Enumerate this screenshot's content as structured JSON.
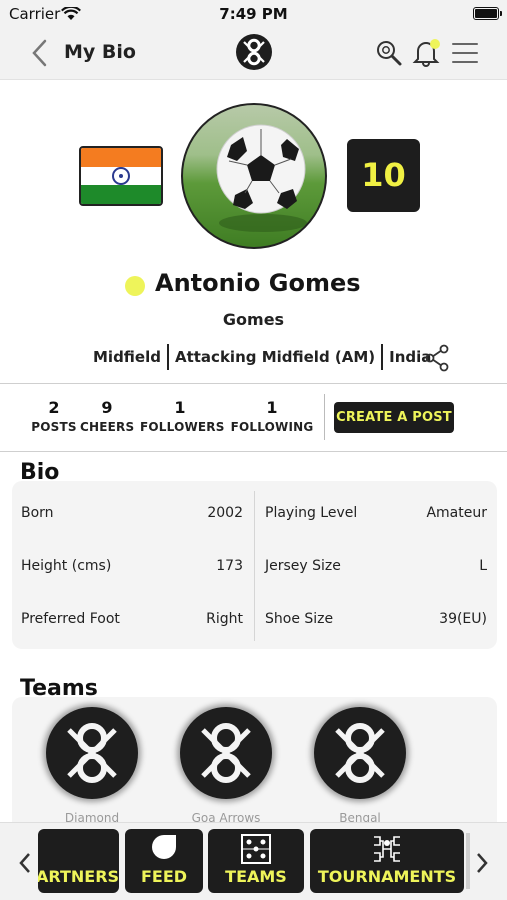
{
  "status_bar": {
    "carrier": "Carrier",
    "time": "7:49 PM"
  },
  "nav": {
    "title": "My Bio"
  },
  "profile": {
    "jersey_number": "10",
    "name": "Antonio Gomes",
    "nickname": "Gomes",
    "positions": [
      "Midfield",
      "Attacking Midfield (AM)",
      "India"
    ],
    "status_color": "#eef45a",
    "flag_colors": [
      "#f47c20",
      "#ffffff",
      "#1e8a2a"
    ]
  },
  "stats": [
    {
      "value": "2",
      "label": "POSTS"
    },
    {
      "value": "9",
      "label": "CHEERS"
    },
    {
      "value": "1",
      "label": "FOLLOWERS"
    },
    {
      "value": "1",
      "label": "FOLLOWING"
    }
  ],
  "create_post_label": "CREATE A POST",
  "bio": {
    "title": "Bio",
    "rows": [
      {
        "label": "Born",
        "value": "2002",
        "label2": "Playing Level",
        "value2": "Amateur"
      },
      {
        "label": "Height (cms)",
        "value": "173",
        "label2": "Jersey Size",
        "value2": "L"
      },
      {
        "label": "Preferred Foot",
        "value": "Right",
        "label2": "Shoe Size",
        "value2": "39(EU)"
      }
    ]
  },
  "teams": {
    "title": "Teams",
    "items": [
      {
        "name": "Diamond"
      },
      {
        "name": "Goa Arrows"
      },
      {
        "name": "Bengal"
      }
    ]
  },
  "bottom_tabs": [
    {
      "label": "PARTNERS",
      "visible_label": "ARTNERS"
    },
    {
      "label": "FEED"
    },
    {
      "label": "TEAMS"
    },
    {
      "label": "TOURNAMENTS"
    }
  ],
  "accent_color": "#eef45a",
  "icons": [
    "back-icon",
    "app-logo-icon",
    "search-icon",
    "bell-icon",
    "menu-icon",
    "share-icon",
    "chevron-left-icon",
    "chevron-right-icon"
  ]
}
